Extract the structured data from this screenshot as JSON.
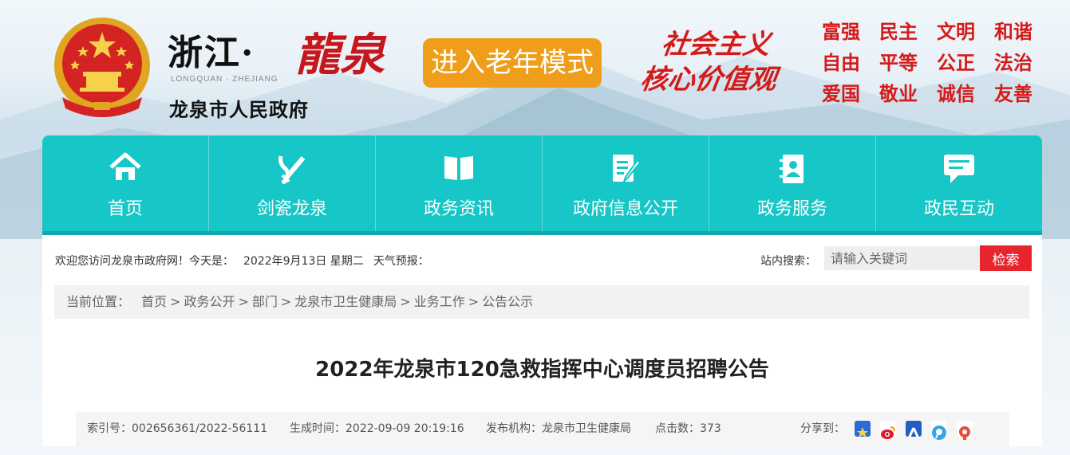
{
  "header": {
    "logo_province": "浙江·",
    "logo_city": "龍泉",
    "logo_english": "LONGQUAN · ZHEJIANG",
    "logo_name": "龙泉市人民政府",
    "elder_mode_label": "进入老年模式",
    "slogan_line1": "社会主义",
    "slogan_line2": "核心价值观",
    "core_values": [
      "富强",
      "民主",
      "文明",
      "和谐",
      "自由",
      "平等",
      "公正",
      "法治",
      "爱国",
      "敬业",
      "诚信",
      "友善"
    ]
  },
  "nav": {
    "items": [
      {
        "label": "首页",
        "icon": "home-icon"
      },
      {
        "label": "剑瓷龙泉",
        "icon": "sword-icon"
      },
      {
        "label": "政务资讯",
        "icon": "book-icon"
      },
      {
        "label": "政府信息公开",
        "icon": "document-edit-icon"
      },
      {
        "label": "政务服务",
        "icon": "contact-book-icon"
      },
      {
        "label": "政民互动",
        "icon": "chat-icon"
      }
    ]
  },
  "topbar": {
    "welcome": "欢迎您访问龙泉市政府网！今天是：",
    "date": "2022年9月13日 星期二",
    "weather_label": "天气预报：",
    "search_label": "站内搜索：",
    "search_placeholder": "请输入关键词",
    "search_button": "检索"
  },
  "breadcrumb": {
    "label": "当前位置：",
    "items": [
      "首页",
      "政务公开",
      "部门",
      "龙泉市卫生健康局",
      "业务工作",
      "公告公示"
    ],
    "separator": ">"
  },
  "article": {
    "title": "2022年龙泉市120急救指挥中心调度员招聘公告",
    "index_no": "索引号：002656361/2022-56111",
    "created": "生成时间：2022-09-09 20:19:16",
    "publisher": "发布机构：龙泉市卫生健康局",
    "clicks": "点击数：373",
    "share_label": "分享到："
  },
  "colors": {
    "nav_bg": "#17c6c6",
    "accent_orange": "#ef9d1a",
    "accent_red": "#d51a1a",
    "search_button": "#e8242d"
  }
}
